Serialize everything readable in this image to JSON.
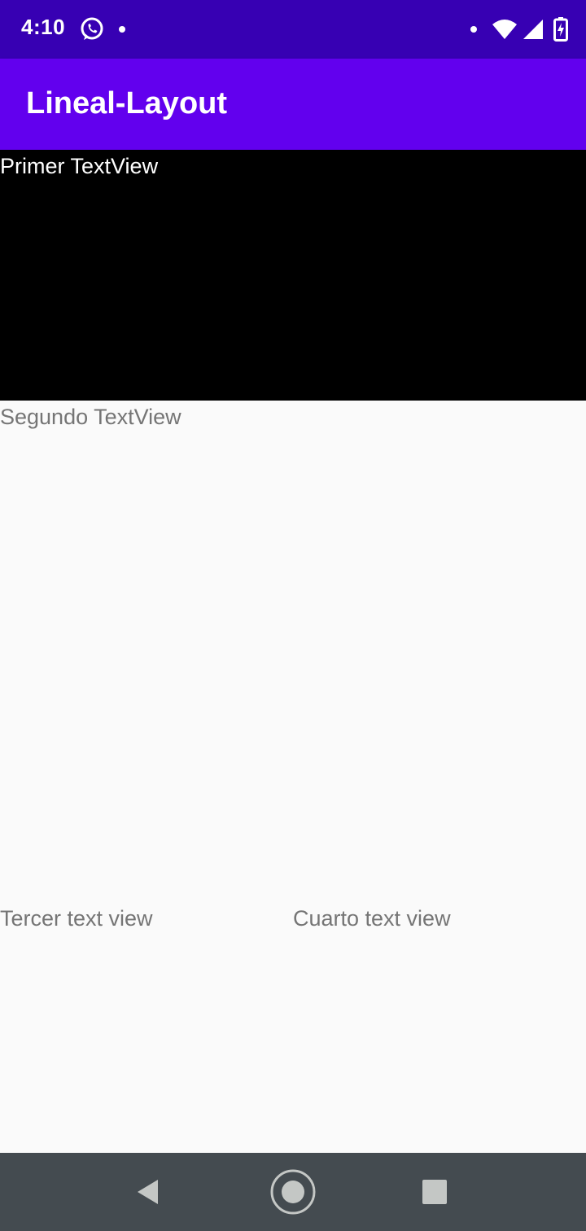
{
  "status_bar": {
    "time": "4:10",
    "left_icons": [
      "whatsapp-icon",
      "notification-dot-icon"
    ],
    "right_icons": [
      "notification-dot-icon",
      "wifi-icon",
      "cell-signal-icon",
      "battery-charging-icon"
    ],
    "background": "#3700b3"
  },
  "app_bar": {
    "title": "Lineal-Layout",
    "background": "#6200ee"
  },
  "content": {
    "first_text": "Primer TextView",
    "second_text": "Segundo TextView",
    "third_text": "Tercer text view",
    "fourth_text": "Cuarto text view",
    "first_background": "#000000"
  },
  "nav_bar": {
    "buttons": [
      "back-icon",
      "home-icon",
      "recents-icon"
    ],
    "background": "#444b50"
  }
}
